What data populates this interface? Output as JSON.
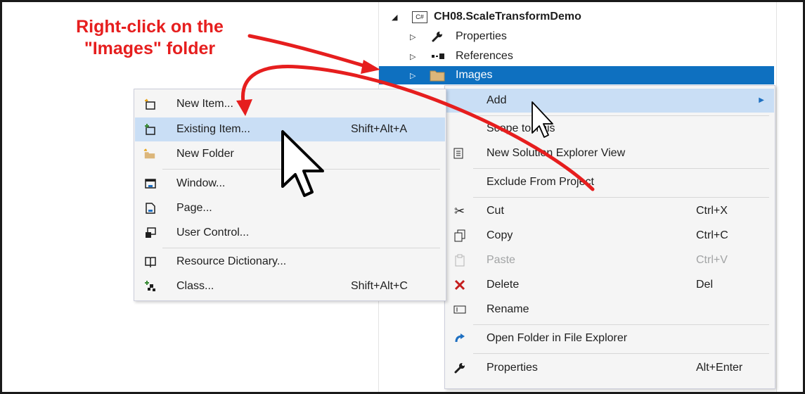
{
  "annotation": {
    "line1": "Right-click on the",
    "line2": "\"Images\" folder"
  },
  "colors": {
    "annotation_red": "#e61e1e",
    "selection_blue": "#0e70c0",
    "menu_highlight": "#c9def5",
    "menu_background": "#f5f5f5"
  },
  "tree": {
    "project": {
      "badge": "C#",
      "label": "CH08.ScaleTransformDemo",
      "icon": "csharp-project-icon",
      "expander": "collapse-triangle-icon"
    },
    "items": [
      {
        "label": "Properties",
        "icon": "wrench-icon"
      },
      {
        "label": "References",
        "icon": "references-icon"
      },
      {
        "label": "Images",
        "icon": "folder-icon",
        "selected": true
      }
    ]
  },
  "context_menu": {
    "items": [
      {
        "label": "Add",
        "has_submenu": true,
        "highlighted": true
      },
      {
        "label": "Scope to This"
      },
      {
        "label": "New Solution Explorer View",
        "icon": "new-view-icon"
      },
      {
        "label": "Exclude From Project"
      },
      {
        "label": "Cut",
        "icon": "scissors-icon",
        "shortcut": "Ctrl+X"
      },
      {
        "label": "Copy",
        "icon": "copy-icon",
        "shortcut": "Ctrl+C"
      },
      {
        "label": "Paste",
        "icon": "paste-icon",
        "shortcut": "Ctrl+V",
        "disabled": true
      },
      {
        "label": "Delete",
        "icon": "delete-x-icon",
        "shortcut": "Del"
      },
      {
        "label": "Rename",
        "icon": "rename-icon"
      },
      {
        "label": "Open Folder in File Explorer",
        "icon": "refresh-arrow-icon"
      },
      {
        "label": "Properties",
        "icon": "wrench-icon",
        "shortcut": "Alt+Enter"
      }
    ]
  },
  "add_submenu": {
    "items": [
      {
        "label": "New Item...",
        "icon": "new-item-icon"
      },
      {
        "label": "Existing Item...",
        "icon": "existing-item-icon",
        "shortcut": "Shift+Alt+A",
        "highlighted": true
      },
      {
        "label": "New Folder",
        "icon": "new-folder-icon"
      },
      {
        "label": "Window...",
        "icon": "window-icon"
      },
      {
        "label": "Page...",
        "icon": "page-icon"
      },
      {
        "label": "User Control...",
        "icon": "user-control-icon"
      },
      {
        "label": "Resource Dictionary...",
        "icon": "resource-dictionary-icon"
      },
      {
        "label": "Class...",
        "icon": "class-icon",
        "shortcut": "Shift+Alt+C"
      }
    ]
  }
}
